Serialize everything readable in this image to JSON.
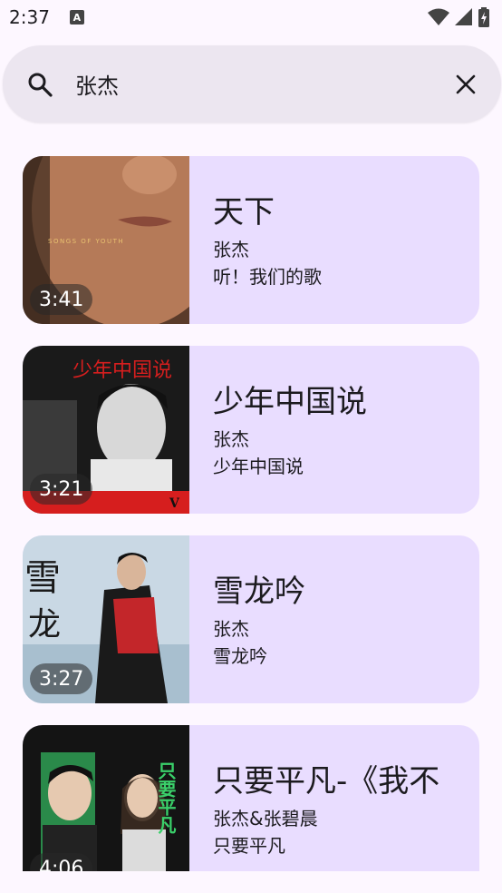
{
  "status_bar": {
    "time": "2:37",
    "notification_icon": "A"
  },
  "search": {
    "query": "张杰",
    "search_icon": "search-icon",
    "clear_icon": "close-icon"
  },
  "songs": [
    {
      "title": "天下",
      "artist": "张杰",
      "album": "听！我们的歌",
      "duration": "3:41"
    },
    {
      "title": "少年中国说",
      "artist": "张杰",
      "album": "少年中国说",
      "duration": "3:21"
    },
    {
      "title": "雪龙吟",
      "artist": "张杰",
      "album": "雪龙吟",
      "duration": "3:27"
    },
    {
      "title": "只要平凡-《我不",
      "artist": "张杰&张碧晨",
      "album": "只要平凡",
      "duration": "4:06"
    }
  ],
  "colors": {
    "background": "#fdf7ff",
    "search_bar": "#ece6f0",
    "card": "#e9ddff"
  }
}
